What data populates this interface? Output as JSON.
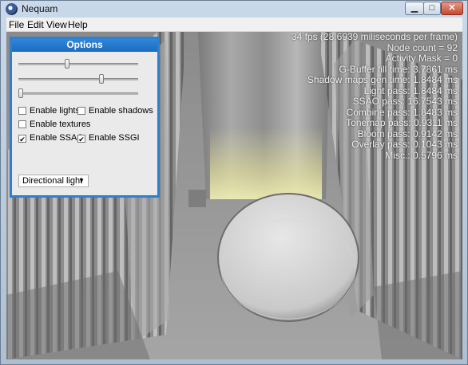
{
  "window": {
    "title": "Nequam"
  },
  "titlebar": {
    "minimize": "▁",
    "maximize": "□",
    "close": "✕"
  },
  "menu": [
    "File",
    "Edit",
    "View",
    "Help"
  ],
  "panel": {
    "title": "Options",
    "sliders": [
      0.4,
      0.7,
      0.0
    ],
    "checkboxes": [
      {
        "label": "Enable lights",
        "checked": false
      },
      {
        "label": "Enable shadows",
        "checked": false
      },
      {
        "label": "Enable textures",
        "checked": false
      },
      {
        "label": "Enable SSAO",
        "checked": true
      },
      {
        "label": "Enable SSGI",
        "checked": true
      }
    ],
    "light_select": "Directional light"
  },
  "stats": [
    "34 fps (28.6939 miliseconds per frame)",
    "Node count = 92",
    "Activity Mask = 0",
    "G-Buffer fill time: 3.7861 ms",
    "Shadow maps gen time: 1.8484 ms",
    "Light pass: 1.8484 ms",
    "SSAO pass: 16.7543 ms",
    "Combine pass: 1.8483 ms",
    "Tonemap pass: 0.9311 ms",
    "Bloom pass: 0.9142 ms",
    "Overlay pass: 0.1043 ms",
    "Misc.: 0.5796 ms"
  ]
}
